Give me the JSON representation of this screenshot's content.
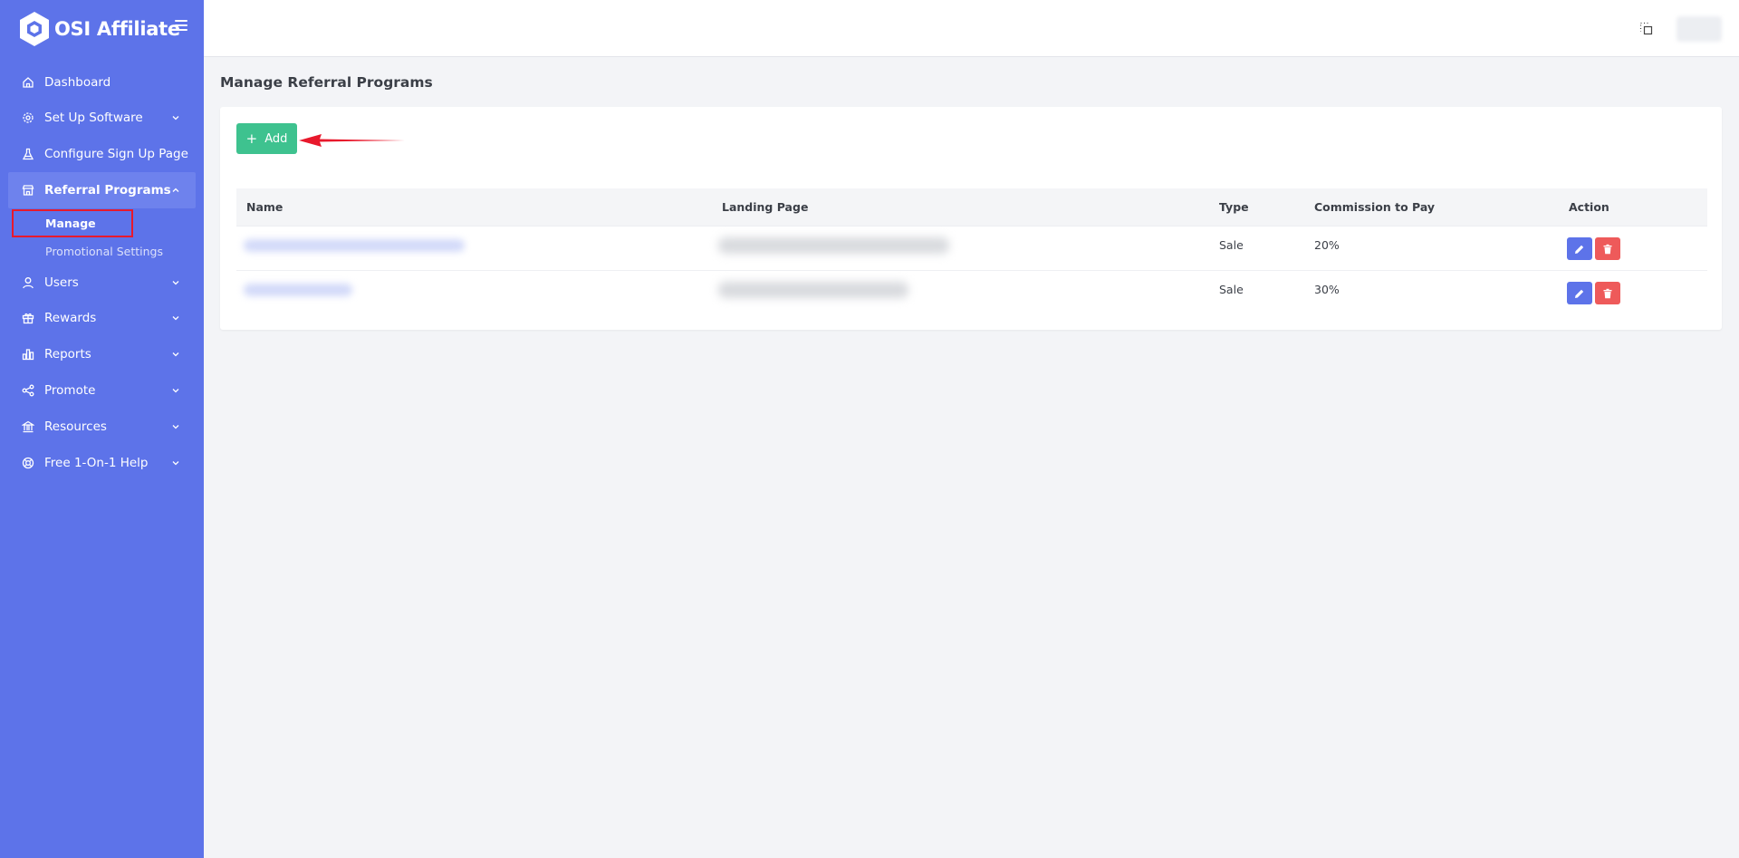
{
  "sidebar": {
    "brand": "OSI Affiliate",
    "items": [
      {
        "label": "Dashboard",
        "icon": "home-icon"
      },
      {
        "label": "Set Up Software",
        "icon": "gear-icon"
      },
      {
        "label": "Configure Sign Up Page",
        "icon": "flask-icon"
      },
      {
        "label": "Referral Programs",
        "icon": "store-icon",
        "expanded": true
      },
      {
        "label": "Users",
        "icon": "user-icon"
      },
      {
        "label": "Rewards",
        "icon": "gift-icon"
      },
      {
        "label": "Reports",
        "icon": "bar-chart-icon"
      },
      {
        "label": "Promote",
        "icon": "share-icon"
      },
      {
        "label": "Resources",
        "icon": "bank-icon"
      },
      {
        "label": "Free 1-On-1 Help",
        "icon": "lifebuoy-icon"
      }
    ],
    "subitems": [
      {
        "label": "Manage",
        "current": true
      },
      {
        "label": "Promotional Settings"
      }
    ]
  },
  "page": {
    "title": "Manage Referral Programs",
    "add_label": "Add"
  },
  "table": {
    "headers": [
      "Name",
      "Landing Page",
      "Type",
      "Commission to Pay",
      "Action"
    ],
    "rows": [
      {
        "type": "Sale",
        "commission": "20%"
      },
      {
        "type": "Sale",
        "commission": "30%"
      }
    ]
  },
  "colors": {
    "sidebar": "#5d73e9",
    "add_button": "#3ec28f",
    "edit_button": "#5d73e9",
    "delete_button": "#ee5a5a",
    "highlight": "#e8192c"
  }
}
